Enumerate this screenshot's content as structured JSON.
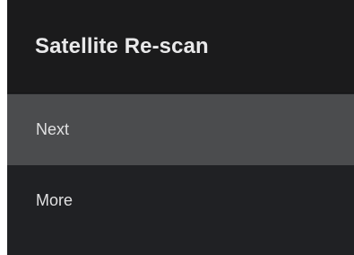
{
  "dialog": {
    "title": "Satellite Re-scan",
    "background": "#202124",
    "header_background": "#1b1b1c",
    "focus_highlight": "#4b4c4e"
  },
  "menu": {
    "items": [
      {
        "label": "Next",
        "focused": true
      },
      {
        "label": "More",
        "focused": false
      }
    ]
  }
}
